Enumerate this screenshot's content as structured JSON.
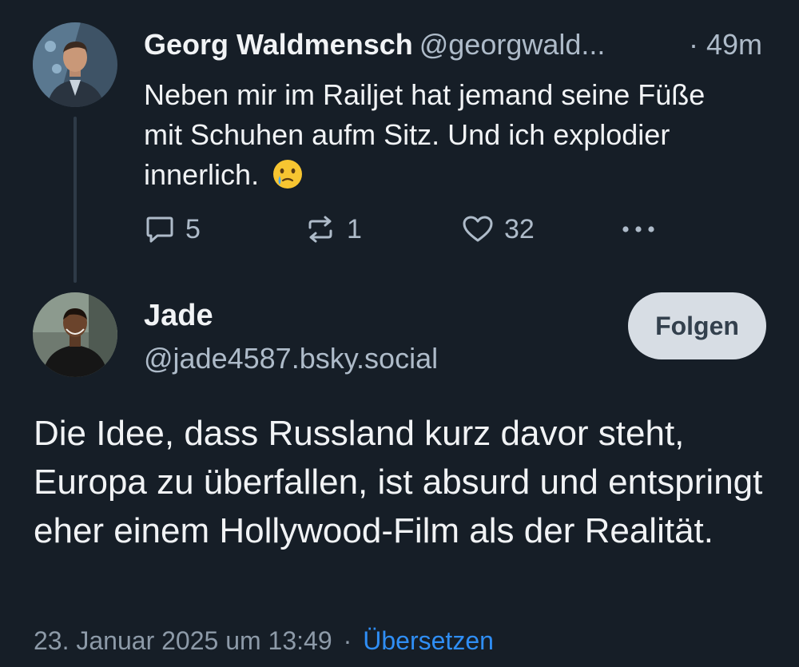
{
  "parent_post": {
    "author_name": "Georg Waldmensch",
    "author_handle": "@georgwald...",
    "time": "· 49m",
    "text": "Neben mir im Railjet hat jemand seine Füße mit Schuhen aufm Sitz. Und ich explodier innerlich.",
    "emoji": "face-holding-back-tears-emoji",
    "replies": "5",
    "reposts": "1",
    "likes": "32"
  },
  "main_post": {
    "author_name": "Jade",
    "author_handle": "@jade4587.bsky.social",
    "follow_label": "Folgen",
    "text": "Die Idee, dass Russland kurz davor steht, Europa zu überfallen, ist absurd und entspringt eher einem Hollywood-Film als der Realität.",
    "timestamp": "23. Januar 2025 um 13:49",
    "separator": "·",
    "translate_label": "Übersetzen"
  },
  "colors": {
    "background": "#161e27",
    "text_primary": "#f1f3f5",
    "text_secondary": "#aebbc9",
    "link": "#2f8ef5",
    "button_bg": "#d7dde4",
    "thread_line": "#2e3a47"
  },
  "icons": {
    "reply": "reply-icon",
    "repost": "repost-icon",
    "like": "heart-icon",
    "more": "more-icon"
  }
}
